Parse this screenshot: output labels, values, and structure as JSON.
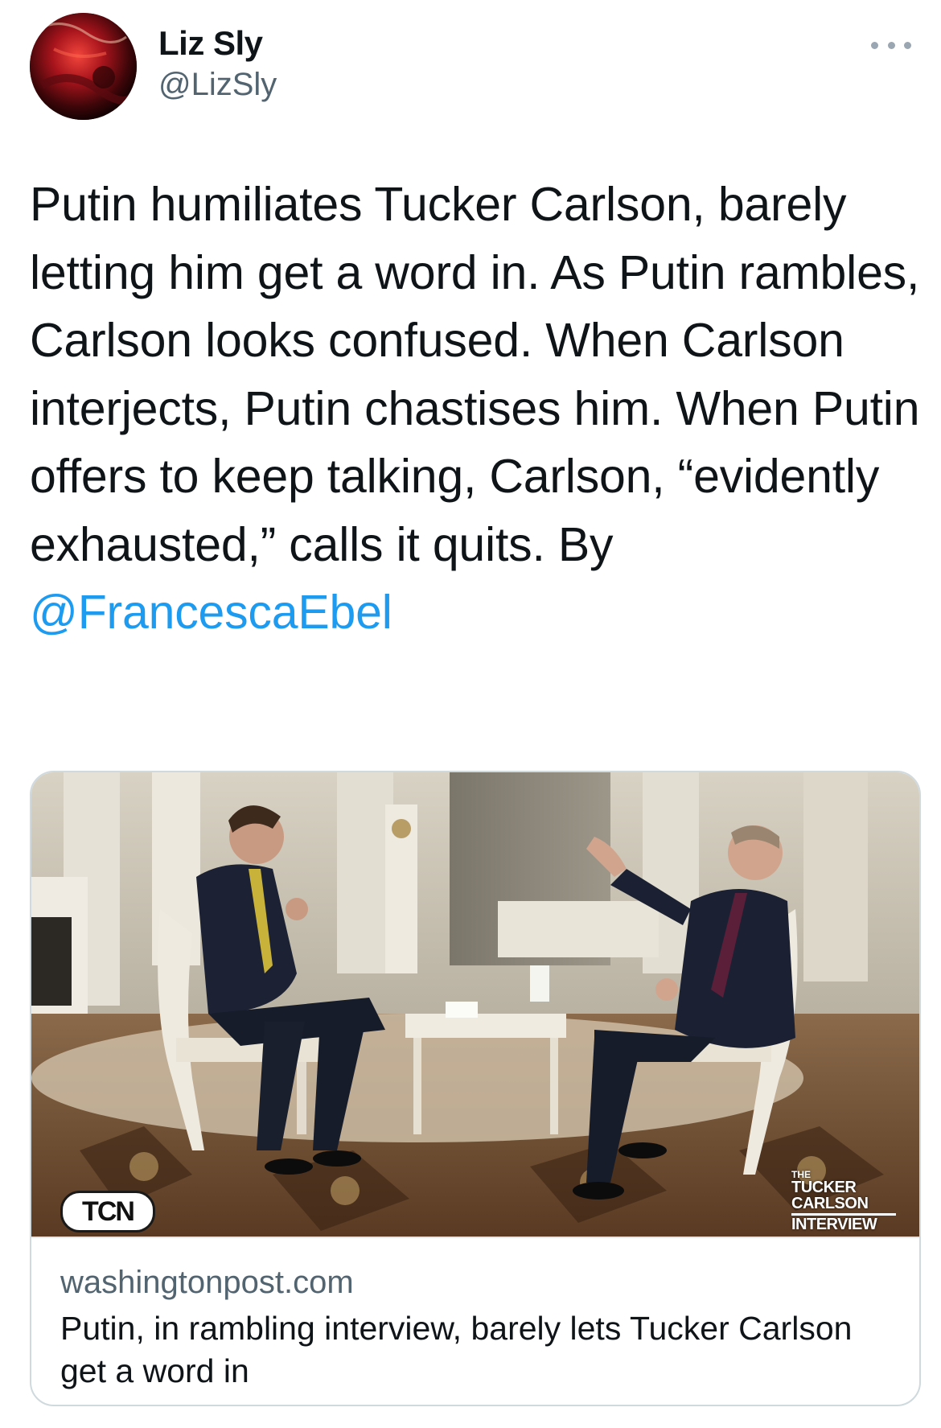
{
  "author": {
    "display_name": "Liz Sly",
    "handle": "@LizSly",
    "avatar_icon": "profile-photo"
  },
  "more_icon": "more-dots-icon",
  "tweet": {
    "text": "Putin humiliates Tucker Carlson, barely letting him get a word in. As Putin rambles, Carlson looks confused. When Carlson interjects, Putin chastises him. When Putin offers to keep talking, Carlson, “evidently exhausted,” calls it quits. By ",
    "mention": "@FrancescaEbel"
  },
  "link_card": {
    "image_badge_left": "TCN",
    "image_badge_right": {
      "line1": "THE",
      "line2": "TUCKER",
      "line3": "CARLSON",
      "line4": "INTERVIEW"
    },
    "domain": "washingtonpost.com",
    "title": "Putin, in rambling interview, barely lets Tucker Carlson get a word in"
  },
  "colors": {
    "text": "#0f1419",
    "secondary": "#536471",
    "link": "#1d9bf0",
    "border": "#cfd9de"
  }
}
